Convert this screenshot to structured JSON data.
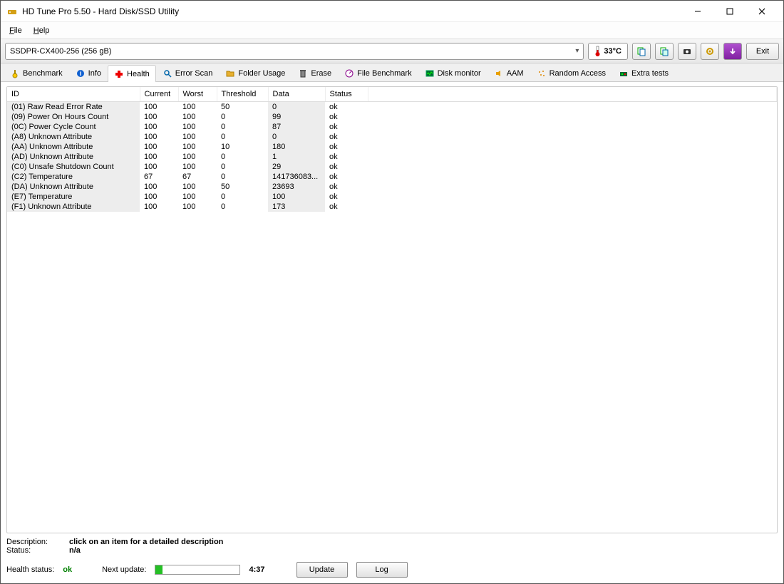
{
  "window": {
    "title": "HD Tune Pro 5.50 - Hard Disk/SSD Utility"
  },
  "menu": {
    "file": "File",
    "help": "Help"
  },
  "toolbar": {
    "drive_selected": "SSDPR-CX400-256 (256 gB)",
    "temperature": "33°C",
    "exit_label": "Exit"
  },
  "tabs": [
    {
      "label": "Benchmark"
    },
    {
      "label": "Info"
    },
    {
      "label": "Health"
    },
    {
      "label": "Error Scan"
    },
    {
      "label": "Folder Usage"
    },
    {
      "label": "Erase"
    },
    {
      "label": "File Benchmark"
    },
    {
      "label": "Disk monitor"
    },
    {
      "label": "AAM"
    },
    {
      "label": "Random Access"
    },
    {
      "label": "Extra tests"
    }
  ],
  "smart": {
    "headers": [
      "ID",
      "Current",
      "Worst",
      "Threshold",
      "Data",
      "Status"
    ],
    "rows": [
      {
        "id": "(01) Raw Read Error Rate",
        "cur": "100",
        "wor": "100",
        "thr": "50",
        "dat": "0",
        "sta": "ok"
      },
      {
        "id": "(09) Power On Hours Count",
        "cur": "100",
        "wor": "100",
        "thr": "0",
        "dat": "99",
        "sta": "ok"
      },
      {
        "id": "(0C) Power Cycle Count",
        "cur": "100",
        "wor": "100",
        "thr": "0",
        "dat": "87",
        "sta": "ok"
      },
      {
        "id": "(A8) Unknown Attribute",
        "cur": "100",
        "wor": "100",
        "thr": "0",
        "dat": "0",
        "sta": "ok"
      },
      {
        "id": "(AA) Unknown Attribute",
        "cur": "100",
        "wor": "100",
        "thr": "10",
        "dat": "180",
        "sta": "ok"
      },
      {
        "id": "(AD) Unknown Attribute",
        "cur": "100",
        "wor": "100",
        "thr": "0",
        "dat": "1",
        "sta": "ok"
      },
      {
        "id": "(C0) Unsafe Shutdown Count",
        "cur": "100",
        "wor": "100",
        "thr": "0",
        "dat": "29",
        "sta": "ok"
      },
      {
        "id": "(C2) Temperature",
        "cur": "67",
        "wor": "67",
        "thr": "0",
        "dat": "141736083...",
        "sta": "ok"
      },
      {
        "id": "(DA) Unknown Attribute",
        "cur": "100",
        "wor": "100",
        "thr": "50",
        "dat": "23693",
        "sta": "ok"
      },
      {
        "id": "(E7) Temperature",
        "cur": "100",
        "wor": "100",
        "thr": "0",
        "dat": "100",
        "sta": "ok"
      },
      {
        "id": "(F1) Unknown Attribute",
        "cur": "100",
        "wor": "100",
        "thr": "0",
        "dat": "173",
        "sta": "ok"
      }
    ]
  },
  "desc": {
    "desc_label": "Description:",
    "desc_value": "click on an item for a detailed description",
    "status_label": "Status:",
    "status_value": "n/a"
  },
  "footer": {
    "health_label": "Health status:",
    "health_value": "ok",
    "next_update_label": "Next update:",
    "progress_pct": 8,
    "time": "4:37",
    "update_btn": "Update",
    "log_btn": "Log"
  }
}
